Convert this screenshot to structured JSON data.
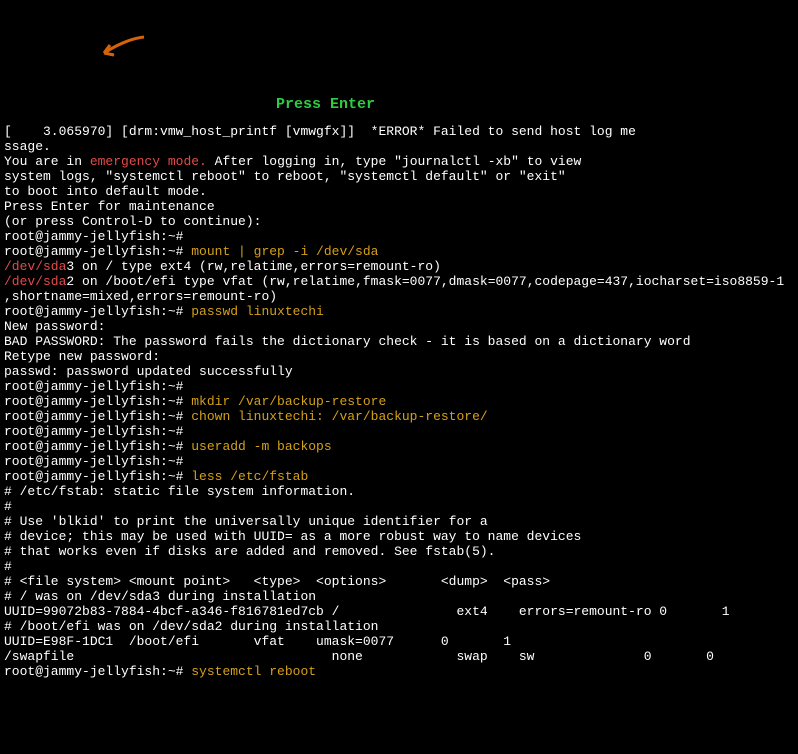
{
  "lines": [
    {
      "segments": [
        {
          "class": "white",
          "text": "[    3.065970] [drm:vmw_host_printf [vmwgfx]]  *ERROR* Failed to send host log me"
        }
      ]
    },
    {
      "segments": [
        {
          "class": "white",
          "text": "ssage."
        }
      ]
    },
    {
      "segments": [
        {
          "class": "white",
          "text": "You are in "
        },
        {
          "class": "red",
          "text": "emergency mode."
        },
        {
          "class": "white",
          "text": " After logging in, type \"journalctl -xb\" to view"
        }
      ]
    },
    {
      "segments": [
        {
          "class": "white",
          "text": "system logs, \"systemctl reboot\" to reboot, \"systemctl default\" or \"exit\""
        }
      ]
    },
    {
      "segments": [
        {
          "class": "white",
          "text": "to boot into default mode."
        }
      ]
    },
    {
      "segments": [
        {
          "class": "white",
          "text": "Press Enter for maintenance"
        }
      ]
    },
    {
      "segments": [
        {
          "class": "white",
          "text": "(or press Control-D to continue): "
        }
      ]
    },
    {
      "segments": [
        {
          "class": "white",
          "text": "root@jammy-jellyfish:~#"
        }
      ]
    },
    {
      "segments": [
        {
          "class": "white",
          "text": "root@jammy-jellyfish:~# "
        },
        {
          "class": "yellow",
          "text": "mount | grep -i /dev/sda"
        }
      ]
    },
    {
      "segments": [
        {
          "class": "red",
          "text": "/dev/sda"
        },
        {
          "class": "white",
          "text": "3 on / type ext4 (rw,relatime,errors=remount-ro)"
        }
      ]
    },
    {
      "segments": [
        {
          "class": "red",
          "text": "/dev/sda"
        },
        {
          "class": "white",
          "text": "2 on /boot/efi type vfat (rw,relatime,fmask=0077,dmask=0077,codepage=437,iocharset=iso8859-1"
        }
      ]
    },
    {
      "segments": [
        {
          "class": "white",
          "text": ",shortname=mixed,errors=remount-ro)"
        }
      ]
    },
    {
      "segments": [
        {
          "class": "white",
          "text": "root@jammy-jellyfish:~# "
        },
        {
          "class": "yellow",
          "text": "passwd linuxtechi"
        }
      ]
    },
    {
      "segments": [
        {
          "class": "white",
          "text": "New password:"
        }
      ]
    },
    {
      "segments": [
        {
          "class": "white",
          "text": "BAD PASSWORD: The password fails the dictionary check - it is based on a dictionary word"
        }
      ]
    },
    {
      "segments": [
        {
          "class": "white",
          "text": "Retype new password:"
        }
      ]
    },
    {
      "segments": [
        {
          "class": "white",
          "text": "passwd: password updated successfully"
        }
      ]
    },
    {
      "segments": [
        {
          "class": "white",
          "text": "root@jammy-jellyfish:~#"
        }
      ]
    },
    {
      "segments": [
        {
          "class": "white",
          "text": "root@jammy-jellyfish:~# "
        },
        {
          "class": "yellow",
          "text": "mkdir /var/backup-restore"
        }
      ]
    },
    {
      "segments": [
        {
          "class": "white",
          "text": "root@jammy-jellyfish:~# "
        },
        {
          "class": "yellow",
          "text": "chown linuxtechi: /var/backup-restore/"
        }
      ]
    },
    {
      "segments": [
        {
          "class": "white",
          "text": "root@jammy-jellyfish:~#"
        }
      ]
    },
    {
      "segments": [
        {
          "class": "white",
          "text": "root@jammy-jellyfish:~# "
        },
        {
          "class": "yellow",
          "text": "useradd -m backops"
        }
      ]
    },
    {
      "segments": [
        {
          "class": "white",
          "text": "root@jammy-jellyfish:~#"
        }
      ]
    },
    {
      "segments": [
        {
          "class": "white",
          "text": "root@jammy-jellyfish:~# "
        },
        {
          "class": "yellow",
          "text": "less /etc/fstab"
        }
      ]
    },
    {
      "segments": [
        {
          "class": "white",
          "text": "# /etc/fstab: static file system information."
        }
      ]
    },
    {
      "segments": [
        {
          "class": "white",
          "text": "#"
        }
      ]
    },
    {
      "segments": [
        {
          "class": "white",
          "text": "# Use 'blkid' to print the universally unique identifier for a"
        }
      ]
    },
    {
      "segments": [
        {
          "class": "white",
          "text": "# device; this may be used with UUID= as a more robust way to name devices"
        }
      ]
    },
    {
      "segments": [
        {
          "class": "white",
          "text": "# that works even if disks are added and removed. See fstab(5)."
        }
      ]
    },
    {
      "segments": [
        {
          "class": "white",
          "text": "#"
        }
      ]
    },
    {
      "segments": [
        {
          "class": "white",
          "text": "# <file system> <mount point>   <type>  <options>       <dump>  <pass>"
        }
      ]
    },
    {
      "segments": [
        {
          "class": "white",
          "text": "# / was on /dev/sda3 during installation"
        }
      ]
    },
    {
      "segments": [
        {
          "class": "white",
          "text": "UUID=99072b83-7884-4bcf-a346-f816781ed7cb /               ext4    errors=remount-ro 0       1"
        }
      ]
    },
    {
      "segments": [
        {
          "class": "white",
          "text": "# /boot/efi was on /dev/sda2 during installation"
        }
      ]
    },
    {
      "segments": [
        {
          "class": "white",
          "text": "UUID=E98F-1DC1  /boot/efi       vfat    umask=0077      0       1"
        }
      ]
    },
    {
      "segments": [
        {
          "class": "white",
          "text": "/swapfile                                 none            swap    sw              0       0"
        }
      ]
    },
    {
      "segments": [
        {
          "class": "white",
          "text": "root@jammy-jellyfish:~# "
        },
        {
          "class": "yellow",
          "text": "systemctl reboot"
        }
      ]
    }
  ],
  "annotation": "Press Enter"
}
